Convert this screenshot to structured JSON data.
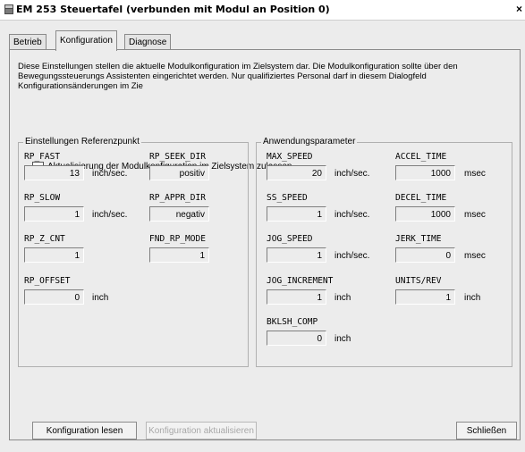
{
  "window": {
    "title": "EM 253 Steuertafel (verbunden mit Modul an Position 0)",
    "close_glyph": "×"
  },
  "tabs": [
    {
      "label": "Betrieb",
      "active": false
    },
    {
      "label": "Konfiguration",
      "active": true
    },
    {
      "label": "Diagnose",
      "active": false
    }
  ],
  "description": "Diese Einstellungen stellen die aktuelle Modulkonfiguration im Zielsystem dar. Die Modulkonfiguration sollte über den Bewegungssteuerungs Assistenten eingerichtet werden. Nur qualifiziertes Personal darf in diesem Dialogfeld Konfigurationsänderungen im Zie",
  "allow_update_checkbox": {
    "label": "Aktualisierung der Modulkonfiguration im Zielsystem zulassen",
    "checked": false
  },
  "reference_group": {
    "title": "Einstellungen Referenzpunkt",
    "fields": {
      "rp_fast": {
        "label": "RP_FAST",
        "value": "13",
        "unit": "inch/sec."
      },
      "rp_seek_dir": {
        "label": "RP_SEEK_DIR",
        "value": "positiv"
      },
      "rp_slow": {
        "label": "RP_SLOW",
        "value": "1",
        "unit": "inch/sec."
      },
      "rp_appr_dir": {
        "label": "RP_APPR_DIR",
        "value": "negativ"
      },
      "rp_z_cnt": {
        "label": "RP_Z_CNT",
        "value": "1"
      },
      "fnd_rp_mode": {
        "label": "FND_RP_MODE",
        "value": "1"
      },
      "rp_offset": {
        "label": "RP_OFFSET",
        "value": "0",
        "unit": "inch"
      }
    }
  },
  "application_group": {
    "title": "Anwendungsparameter",
    "fields": {
      "max_speed": {
        "label": "MAX_SPEED",
        "value": "20",
        "unit": "inch/sec."
      },
      "accel_time": {
        "label": "ACCEL_TIME",
        "value": "1000",
        "unit": "msec"
      },
      "ss_speed": {
        "label": "SS_SPEED",
        "value": "1",
        "unit": "inch/sec."
      },
      "decel_time": {
        "label": "DECEL_TIME",
        "value": "1000",
        "unit": "msec"
      },
      "jog_speed": {
        "label": "JOG_SPEED",
        "value": "1",
        "unit": "inch/sec."
      },
      "jerk_time": {
        "label": "JERK_TIME",
        "value": "0",
        "unit": "msec"
      },
      "jog_increment": {
        "label": "JOG_INCREMENT",
        "value": "1",
        "unit": "inch"
      },
      "units_rev": {
        "label": "UNITS/REV",
        "value": "1",
        "unit": "inch"
      },
      "bklsh_comp": {
        "label": "BKLSH_COMP",
        "value": "0",
        "unit": "inch"
      }
    }
  },
  "buttons": {
    "read_config": "Konfiguration lesen",
    "update_config": "Konfiguration aktualisieren",
    "close": "Schließen"
  }
}
